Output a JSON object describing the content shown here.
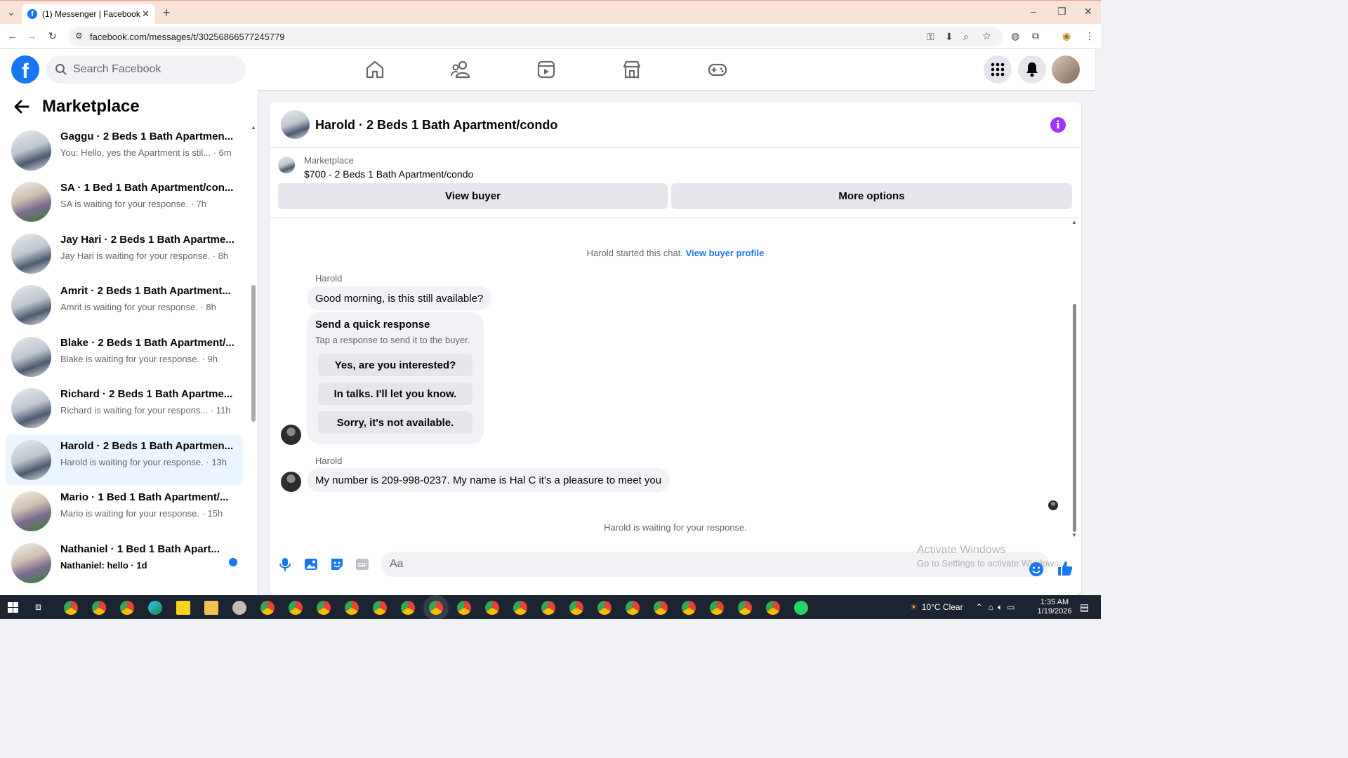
{
  "browser": {
    "tab_title": "(1) Messenger | Facebook",
    "url": "facebook.com/messages/t/30256866577245779"
  },
  "header": {
    "search_placeholder": "Search Facebook"
  },
  "sidebar": {
    "title": "Marketplace",
    "conversations": [
      {
        "name": "Gaggu · 2 Beds 1 Bath Apartmen...",
        "subtitle": "You: Hello, yes the Apartment is stil... · 6m",
        "unread": false
      },
      {
        "name": "SA · 1 Bed 1 Bath Apartment/con...",
        "subtitle": "SA is waiting for your response. · 7h",
        "unread": false
      },
      {
        "name": "Jay Hari · 2 Beds 1 Bath Apartme...",
        "subtitle": "Jay Hari is waiting for your response. · 8h",
        "unread": false
      },
      {
        "name": "Amrit · 2 Beds 1 Bath Apartment...",
        "subtitle": "Amrit is waiting for your response. · 8h",
        "unread": false
      },
      {
        "name": "Blake · 2 Beds 1 Bath Apartment/...",
        "subtitle": "Blake is waiting for your response. · 9h",
        "unread": false
      },
      {
        "name": "Richard · 2 Beds 1 Bath Apartme...",
        "subtitle": "Richard is waiting for your respons... · 11h",
        "unread": false
      },
      {
        "name": "Harold · 2 Beds 1 Bath Apartmen...",
        "subtitle": "Harold is waiting for your response. · 13h",
        "unread": false
      },
      {
        "name": "Mario · 1 Bed 1 Bath Apartment/...",
        "subtitle": "Mario is waiting for your response. · 15h",
        "unread": false
      },
      {
        "name": "Nathaniel · 1 Bed 1 Bath Apart...",
        "subtitle": "Nathaniel: hello · 1d",
        "unread": true
      }
    ]
  },
  "chat": {
    "title": "Harold · 2 Beds 1 Bath Apartment/condo",
    "listing_source": "Marketplace",
    "listing_price": "$700 - 2 Beds 1 Bath Apartment/condo",
    "view_buyer_label": "View buyer",
    "more_options_label": "More options",
    "started_text": "Harold started this chat.",
    "view_profile_link": "View buyer profile",
    "sender_name": "Harold",
    "message_1": "Good morning, is this still available?",
    "quick_title": "Send a quick response",
    "quick_subtitle": "Tap a response to send it to the buyer.",
    "quick_responses": [
      "Yes, are you interested?",
      "In talks. I'll let you know.",
      "Sorry, it's not available."
    ],
    "message_2": "My number is 209-998-0237. My name is Hal C it's a pleasure to meet you",
    "waiting_text": "Harold is waiting for your response.",
    "input_placeholder": "Aa"
  },
  "watermark": {
    "line1": "Activate Windows",
    "line2": "Go to Settings to activate Windows."
  },
  "taskbar": {
    "weather": "10°C  Clear",
    "time": "1:35 AM",
    "date": "1/19/2026"
  },
  "colors": {
    "fb_blue": "#1877f2",
    "info_purple": "#a033ff",
    "tab_bar": "#f8e1d6",
    "taskbar": "#1c2331"
  }
}
